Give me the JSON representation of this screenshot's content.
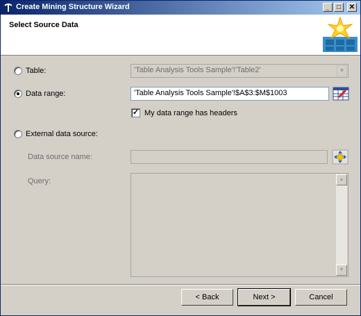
{
  "window": {
    "title": "Create Mining Structure Wizard",
    "controls": {
      "minimize": "_",
      "maximize": "□",
      "close": "✕"
    }
  },
  "header": {
    "heading": "Select Source Data"
  },
  "options": {
    "table": {
      "label": "Table:",
      "value": "'Table Analysis Tools Sample'!'Table2'",
      "selected": false,
      "enabled": false
    },
    "data_range": {
      "label": "Data range:",
      "value": "'Table Analysis Tools Sample'!$A$3:$M$1003",
      "selected": true,
      "headers_checkbox_label": "My data range has headers",
      "headers_checked": true
    },
    "external": {
      "label": "External data source:",
      "selected": false,
      "data_source_label": "Data source name:",
      "data_source_value": "",
      "query_label": "Query:",
      "query_value": ""
    }
  },
  "buttons": {
    "back": "< Back",
    "next": "Next >",
    "cancel": "Cancel"
  },
  "icons": {
    "app": "pickaxe-icon",
    "wizard": "wizard-star-icon",
    "range_picker": "range-picker-icon",
    "data_source_picker": "data-source-icon"
  }
}
